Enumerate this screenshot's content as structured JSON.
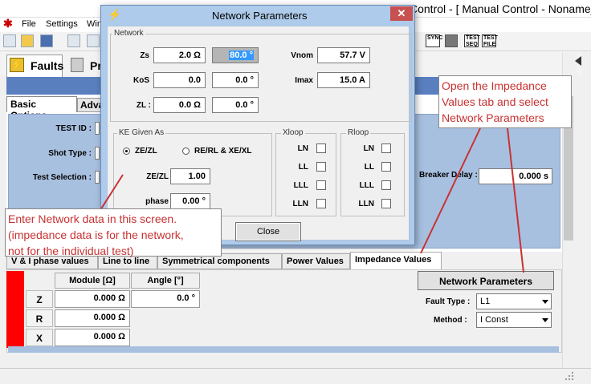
{
  "main": {
    "title": "Control - [ Manual Control - Noname_",
    "menu": [
      "File",
      "Settings",
      "Win"
    ],
    "toolbar_badges": [
      "SYNC",
      "TEST SEQ",
      "TEST FILE"
    ],
    "faults_tab": "Faults",
    "pr_tab": "Pr",
    "basic_tab": "Basic Options",
    "adva_tab": "Advanced",
    "test_id_label": "TEST ID :",
    "shot_type_label": "Shot Type :",
    "test_selection_label": "Test Selection :",
    "breaker_delay_label": "Breaker Delay :",
    "breaker_delay_value": "0.000 s",
    "lower_tabs": [
      {
        "label": "V & I phase values",
        "active": false
      },
      {
        "label": "Line to line",
        "active": false
      },
      {
        "label": "Symmetrical components",
        "active": false
      },
      {
        "label": "Power Values",
        "active": false
      },
      {
        "label": "Impedance Values",
        "active": true
      }
    ],
    "impedance_table": {
      "headers": [
        "Module [Ω]",
        "Angle [°]"
      ],
      "rows": [
        {
          "label": "Z",
          "module": "0.000 Ω",
          "angle": "0.0 °"
        },
        {
          "label": "R",
          "module": "0.000 Ω"
        },
        {
          "label": "X",
          "module": "0.000 Ω"
        }
      ]
    },
    "network_parameters_button": "Network Parameters",
    "fault_type_label": "Fault Type :",
    "fault_type_value": "L1",
    "method_label": "Method :",
    "method_value": "I Const"
  },
  "dialog": {
    "title": "Network Parameters",
    "close_glyph": "✕",
    "network_group": "Network",
    "zs_label": "Zs",
    "zs_module": "2.0 Ω",
    "zs_angle": "80.0 °",
    "kos_label": "KoS",
    "kos_module": "0.0",
    "kos_angle": "0.0 °",
    "zl_label": "ZL :",
    "zl_module": "0.0 Ω",
    "zl_angle": "0.0 °",
    "vnom_label": "Vnom",
    "vnom_value": "57.7 V",
    "imax_label": "Imax",
    "imax_value": "15.0 A",
    "ke_group": "KE Given As",
    "radio_zezl": "ZE/ZL",
    "radio_rerl": "RE/RL & XE/XL",
    "zezl_label": "ZE/ZL",
    "zezl_value": "1.00",
    "phase_label": "phase",
    "phase_value": "0.00 °",
    "xloop_group": "Xloop",
    "rloop_group": "Rloop",
    "loops": [
      "LN",
      "LL",
      "LLL",
      "LLN"
    ],
    "close_button": "Close"
  },
  "callouts": {
    "left_lines": [
      "Enter Network data in this screen.",
      "(impedance data is for the network,",
      "not for the individual test)"
    ],
    "right_lines": [
      "Open the Impedance",
      "Values tab and select",
      "Network Parameters"
    ]
  },
  "colors": {
    "callout_text": "#c83232",
    "settings_blue": "#a8c0e0",
    "band_blue": "#5a7fbf",
    "dialog_frame": "#aecbeb",
    "red_strip": "#ff0000"
  }
}
